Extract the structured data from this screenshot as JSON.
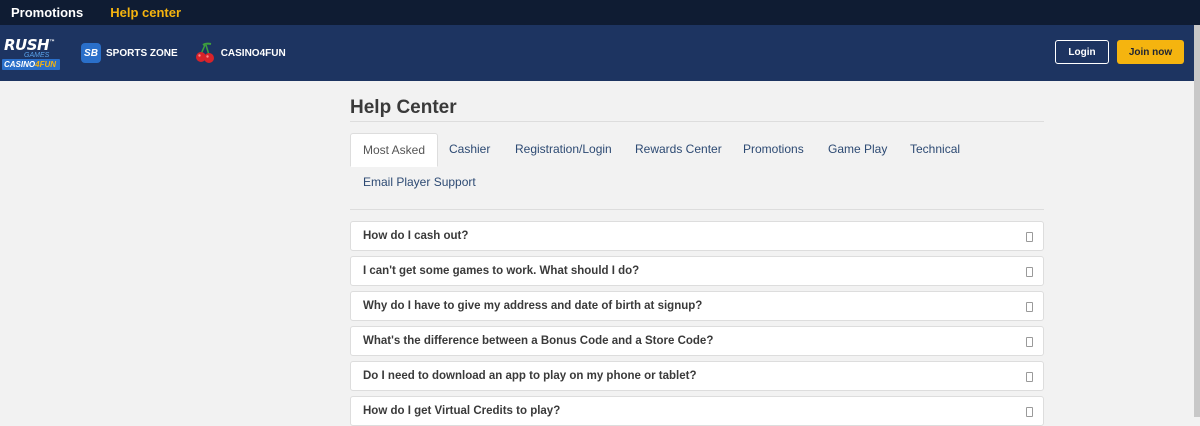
{
  "topnav": {
    "items": [
      {
        "label": "Promotions",
        "active": false
      },
      {
        "label": "Help center",
        "active": true
      }
    ]
  },
  "header": {
    "logo": {
      "line1": "RUSH",
      "line2": "GAMES",
      "line3a": "CASINO",
      "line3b": "4FUN"
    },
    "sports_badge": "SB",
    "sports_label": "SPORTS ZONE",
    "casino_label": "CASINO4FUN",
    "login_label": "Login",
    "join_label": "Join now"
  },
  "colors": {
    "accent": "#f5b40f",
    "header_bg": "#1d3461",
    "topbar_bg": "#0f1c33",
    "link": "#2d4a73"
  },
  "help": {
    "title": "Help Center",
    "tabs": [
      {
        "label": "Most Asked",
        "active": true
      },
      {
        "label": "Cashier"
      },
      {
        "label": "Registration/Login"
      },
      {
        "label": "Rewards Center"
      },
      {
        "label": "Promotions"
      },
      {
        "label": "Game Play"
      },
      {
        "label": "Technical"
      },
      {
        "label": "Email Player Support"
      }
    ],
    "questions": [
      "How do I cash out?",
      "I can't get some games to work. What should I do?",
      "Why do I have to give my address and date of birth at signup?",
      "What's the difference between a Bonus Code and a Store Code?",
      "Do I need to download an app to play on my phone or tablet?",
      "How do I get Virtual Credits to play?"
    ]
  }
}
